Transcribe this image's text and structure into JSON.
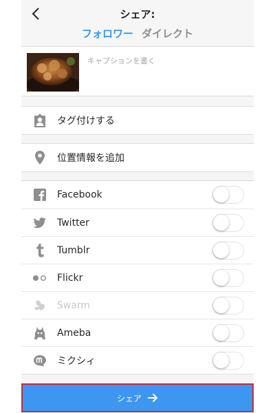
{
  "header": {
    "title": "シェア:",
    "tabs": [
      {
        "label": "フォロワー",
        "active": true
      },
      {
        "label": "ダイレクト",
        "active": false
      }
    ]
  },
  "caption": {
    "placeholder": "キャプションを書く"
  },
  "options": {
    "tag_people": "タグ付けする",
    "add_location": "位置情報を追加"
  },
  "share_targets": [
    {
      "label": "Facebook",
      "icon": "facebook-icon",
      "enabled": false,
      "disabled": false
    },
    {
      "label": "Twitter",
      "icon": "twitter-icon",
      "enabled": false,
      "disabled": false
    },
    {
      "label": "Tumblr",
      "icon": "tumblr-icon",
      "enabled": false,
      "disabled": false
    },
    {
      "label": "Flickr",
      "icon": "flickr-icon",
      "enabled": false,
      "disabled": false
    },
    {
      "label": "Swarm",
      "icon": "swarm-icon",
      "enabled": false,
      "disabled": true
    },
    {
      "label": "Ameba",
      "icon": "ameba-icon",
      "enabled": false,
      "disabled": false
    },
    {
      "label": "ミクシィ",
      "icon": "mixi-icon",
      "enabled": false,
      "disabled": false
    }
  ],
  "share_button": {
    "label": "シェア",
    "icon": "arrow-right-icon"
  },
  "colors": {
    "accent": "#3897f0",
    "button_bg": "#3d97f0",
    "button_outline": "#cc2a36",
    "icon_gray": "#8e8e8e"
  }
}
